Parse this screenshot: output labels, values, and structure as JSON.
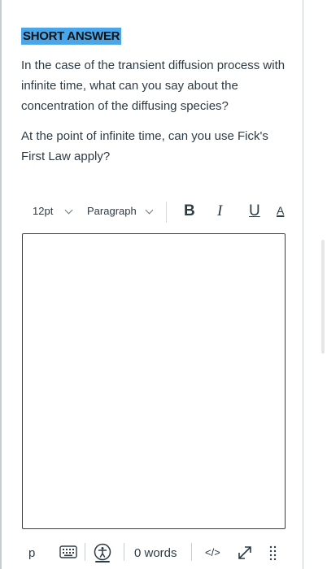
{
  "question": {
    "type_badge": "SHORT ANSWER",
    "paragraphs": [
      "In the case of the transient diffusion process with infinite time, what can you say about the concentration of the diffusing species?",
      "At the point of infinite time, can you use Fick's First Law apply?"
    ]
  },
  "toolbar": {
    "font_size": "12pt",
    "block_format": "Paragraph",
    "bold": "B",
    "italic": "I",
    "underline": "U",
    "text_color": "A"
  },
  "editor": {
    "value": ""
  },
  "statusbar": {
    "element_path": "p",
    "word_count": "0 words",
    "html_toggle": "</>"
  },
  "colors": {
    "badge_bg": "#4aa6e8",
    "text": "#2d3b45",
    "editor_border": "#3c3c3c"
  }
}
